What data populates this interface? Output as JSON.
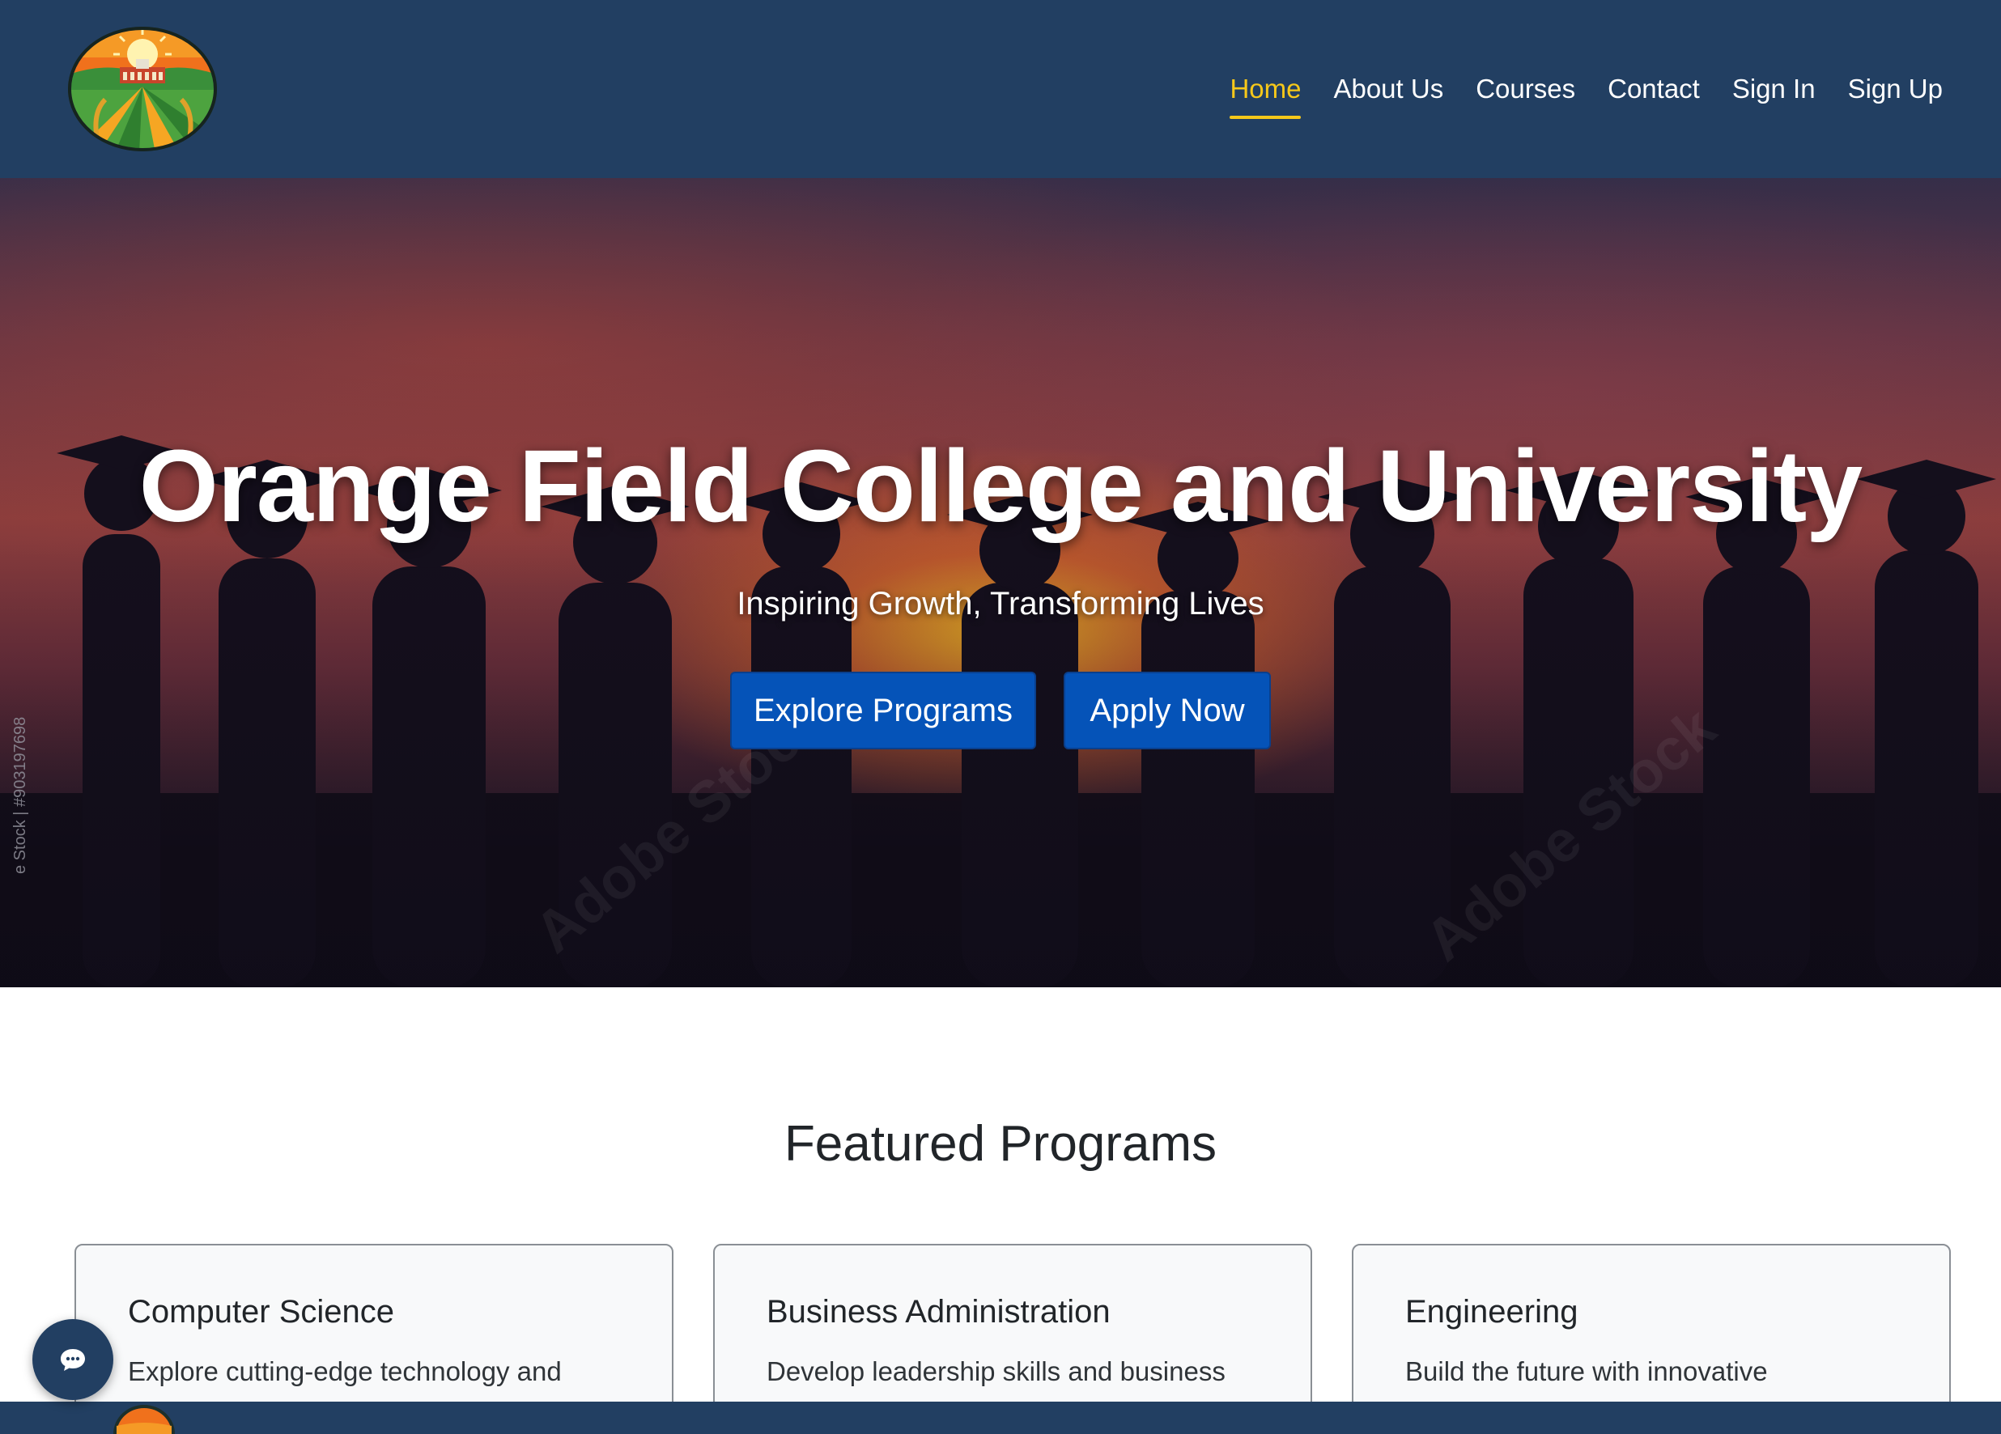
{
  "header": {
    "logo_alt": "Orange Field College and University logo",
    "nav": [
      {
        "label": "Home",
        "active": true
      },
      {
        "label": "About Us",
        "active": false
      },
      {
        "label": "Courses",
        "active": false
      },
      {
        "label": "Contact",
        "active": false
      },
      {
        "label": "Sign In",
        "active": false
      },
      {
        "label": "Sign Up",
        "active": false
      }
    ]
  },
  "hero": {
    "title": "Orange Field College and University",
    "subtitle": "Inspiring Growth, Transforming Lives",
    "buttons": {
      "explore": "Explore Programs",
      "apply": "Apply Now"
    },
    "watermark_side": "e Stock | #903197698",
    "watermark_diag": "Adobe Stock"
  },
  "featured": {
    "title": "Featured Programs",
    "cards": [
      {
        "title": "Computer Science",
        "description": "Explore cutting-edge technology and"
      },
      {
        "title": "Business Administration",
        "description": "Develop leadership skills and business"
      },
      {
        "title": "Engineering",
        "description": "Build the future with innovative"
      }
    ]
  },
  "chat": {
    "icon": "chat-bubble-icon"
  },
  "colors": {
    "navbar": "#223f62",
    "nav_active": "#f6c81a",
    "button": "#0553b8",
    "card_bg": "#f8f9fa"
  }
}
